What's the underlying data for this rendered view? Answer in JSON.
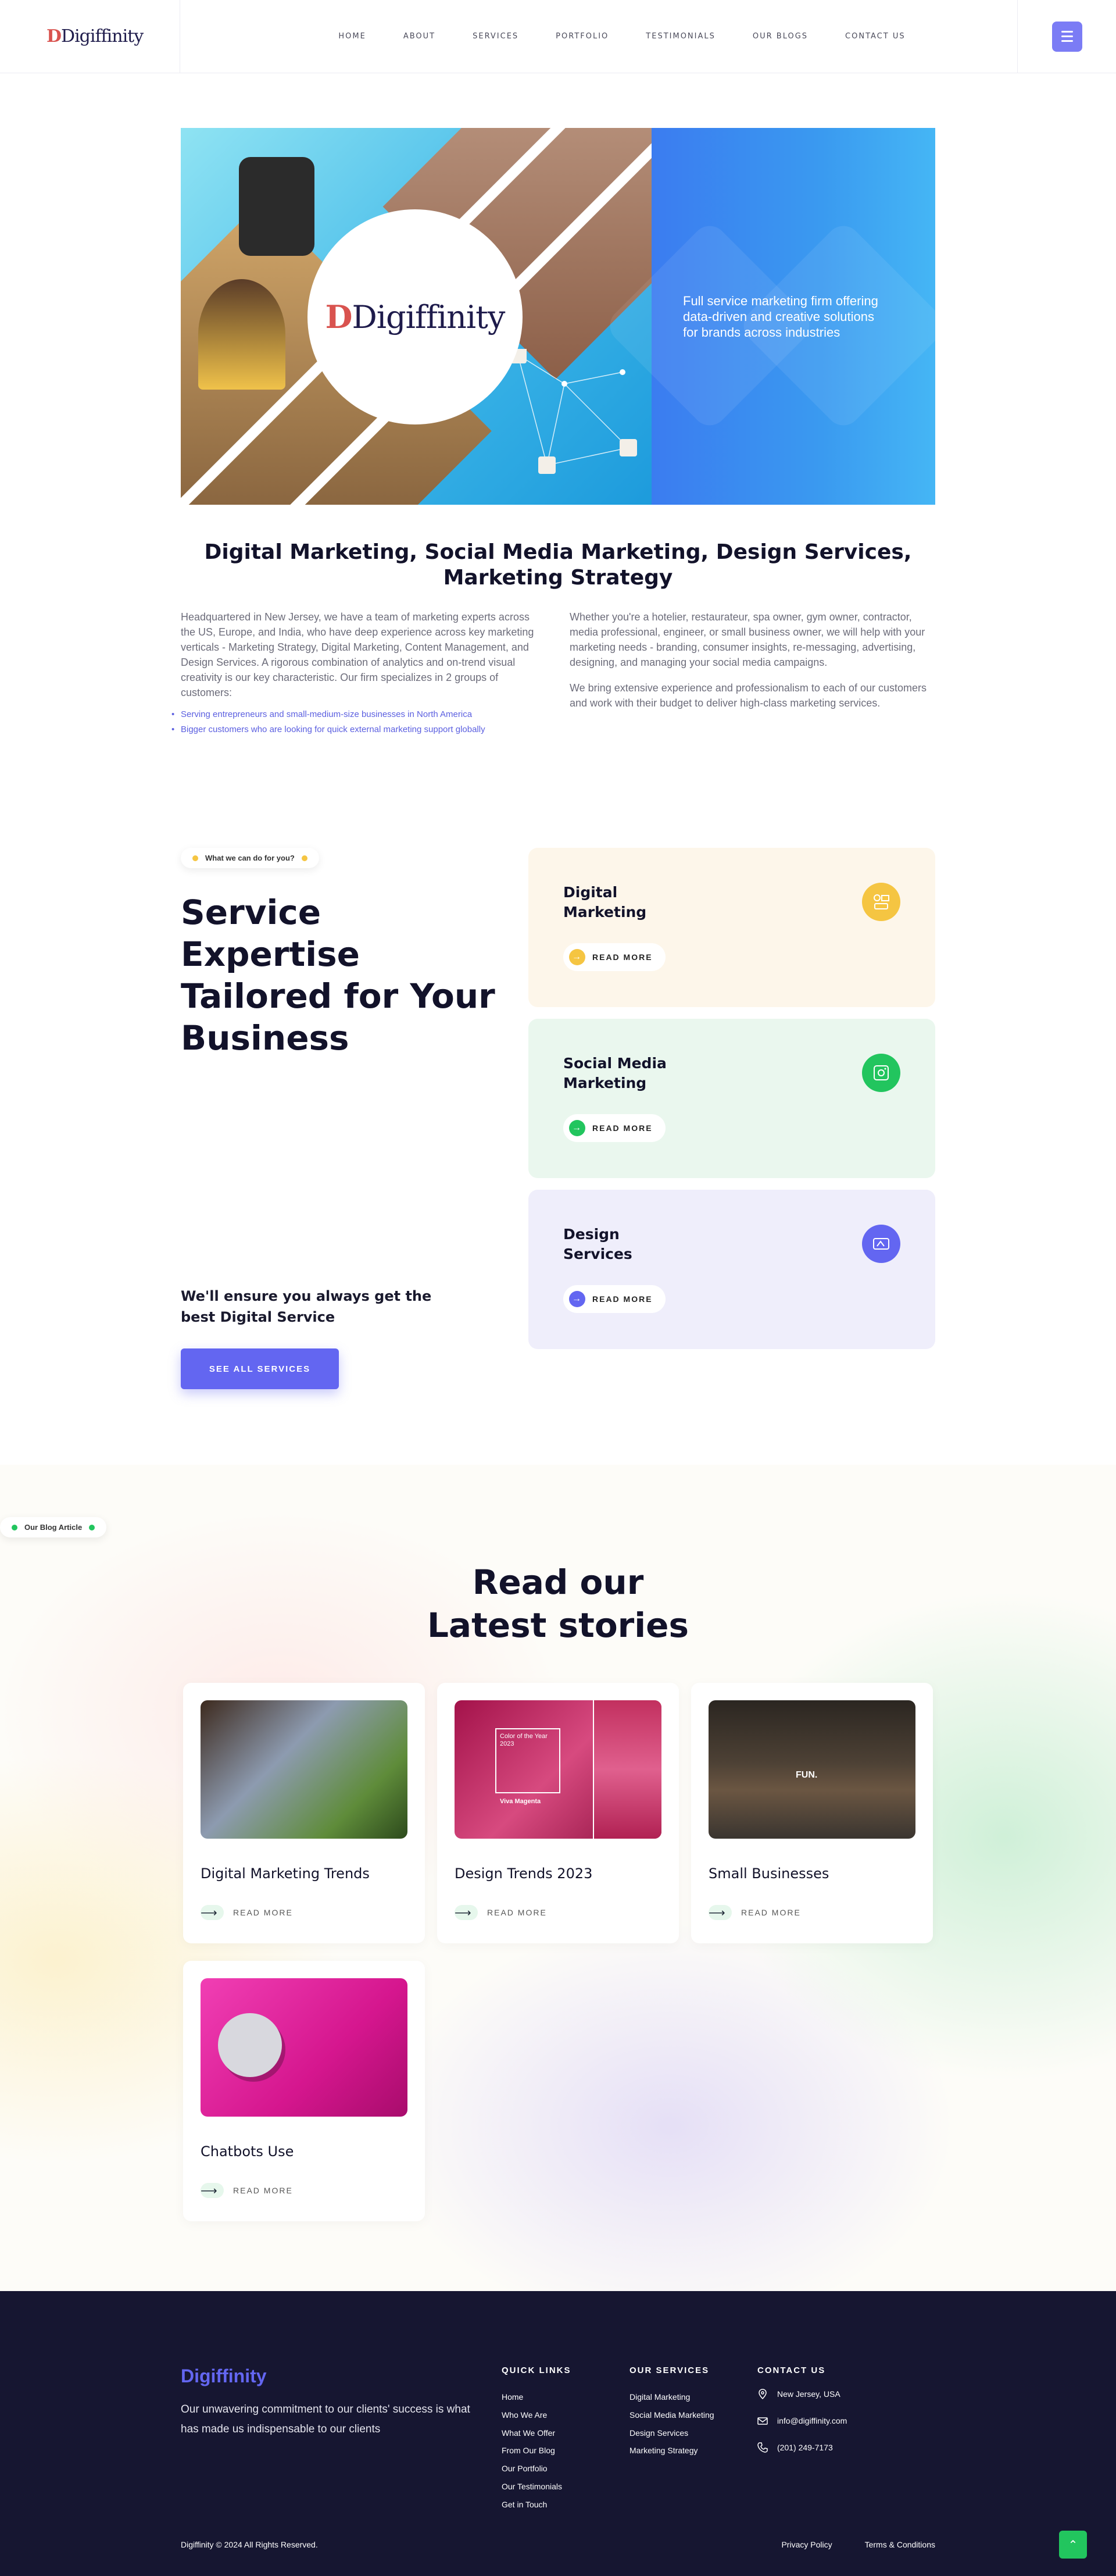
{
  "header": {
    "logo": "Digiffinity",
    "nav": [
      "HOME",
      "ABOUT",
      "SERVICES",
      "PORTFOLIO",
      "TESTIMONIALS",
      "OUR BLOGS",
      "CONTACT US"
    ]
  },
  "hero": {
    "logo": "Digiffinity",
    "tagline": "Full service marketing firm offering data-driven and creative solutions for brands across industries"
  },
  "intro": {
    "title": "Digital Marketing, Social Media Marketing, Design Services, Marketing Strategy",
    "left_text": "Headquartered in New Jersey, we have a team of marketing experts across the US, Europe, and India, who have deep experience across key marketing verticals - Marketing Strategy, Digital Marketing, Content Management, and Design Services. A rigorous combination of analytics and on-trend visual creativity is our key characteristic. Our firm specializes in 2 groups of customers:",
    "bullets": [
      "Serving entrepreneurs and small-medium-size businesses in North America",
      "Bigger customers who are looking for quick external marketing support globally"
    ],
    "right_p1": "Whether you're a hotelier, restaurateur, spa owner, gym owner, contractor, media professional, engineer, or small business owner, we will help with your marketing needs - branding, consumer insights, re-messaging, advertising, designing, and managing your social media campaigns.",
    "right_p2": "We bring extensive experience and professionalism to each of our customers and work with their budget to deliver high-class marketing services."
  },
  "services": {
    "pill": "What we can do for you?",
    "title": "Service Expertise Tailored for Your Business",
    "subtitle": "We'll ensure you always get the best Digital Service",
    "button": "SEE ALL SERVICES",
    "cards": [
      {
        "title": "Digital Marketing",
        "read_more": "READ MORE",
        "icon": "digital-marketing-icon",
        "bg": "#fdf6ea",
        "accent": "#f5c542"
      },
      {
        "title": "Social Media Marketing",
        "read_more": "READ MORE",
        "icon": "social-media-icon",
        "bg": "#eaf7ee",
        "accent": "#22c55e"
      },
      {
        "title": "Design Services",
        "read_more": "READ MORE",
        "icon": "design-icon",
        "bg": "#efeefb",
        "accent": "#6366f1"
      }
    ]
  },
  "blog": {
    "pill": "Our Blog Article",
    "title": "Read our Latest stories",
    "cards": [
      {
        "title": "Digital Marketing Trends",
        "read_more": "READ MORE"
      },
      {
        "title": "Design Trends 2023",
        "read_more": "READ MORE",
        "overlay_top": "Color of the Year 2023",
        "overlay_bottom": "Viva Magenta"
      },
      {
        "title": "Small Businesses",
        "read_more": "READ MORE",
        "overlay_shirt": "FUN."
      },
      {
        "title": "Chatbots Use",
        "read_more": "READ MORE"
      }
    ]
  },
  "footer": {
    "brand": "Digiffinity",
    "tagline": "Our unwavering commitment to our clients' success is what has made us indispensable to our clients",
    "quick_links_title": "QUICK LINKS",
    "quick_links": [
      "Home",
      "Who We Are",
      "What We Offer",
      "From Our Blog",
      "Our Portfolio",
      "Our Testimonials",
      "Get in Touch"
    ],
    "services_title": "OUR SERVICES",
    "services": [
      "Digital Marketing",
      "Social Media Marketing",
      "Design Services",
      "Marketing Strategy"
    ],
    "contact_title": "CONTACT US",
    "contact": {
      "location": "New Jersey, USA",
      "email": "info@digiffinity.com",
      "phone": "(201) 249-7173"
    },
    "copyright": "Digiffinity © 2024 All Rights Reserved.",
    "privacy": "Privacy Policy",
    "terms": "Terms & Conditions"
  }
}
